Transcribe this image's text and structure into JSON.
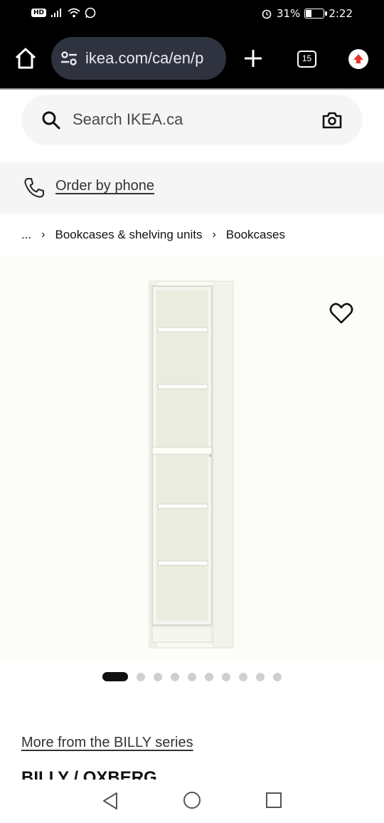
{
  "status_bar": {
    "hd_badge": "HD",
    "battery": "31%",
    "battery_level": 0.31,
    "time": "2:22"
  },
  "browser": {
    "url": "ikea.com/ca/en/p",
    "tab_count": "15"
  },
  "search": {
    "placeholder": "Search IKEA.ca"
  },
  "order_by_phone": {
    "label": "Order by phone"
  },
  "breadcrumb": {
    "ellipsis": "...",
    "items": [
      "Bookcases & shelving units",
      "Bookcases"
    ]
  },
  "gallery": {
    "total_images": 10,
    "active_index": 0
  },
  "series_link": "More from the BILLY series",
  "product_name": "BILLY / OXBERG",
  "colors": {
    "chrome_bg": "#000000",
    "url_bar_bg": "#2f3340",
    "update_icon": "#e8372c",
    "panel_bg": "#f5f5f5"
  },
  "icons": {
    "home": "home-icon",
    "tune": "site-settings-icon",
    "plus": "new-tab-icon",
    "update": "update-arrow-icon",
    "search": "search-icon",
    "camera": "camera-icon",
    "phone": "phone-icon",
    "favorite": "heart-icon"
  }
}
